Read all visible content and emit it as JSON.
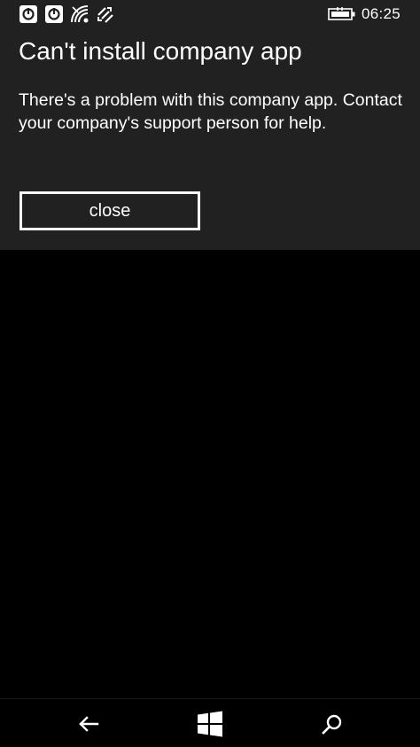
{
  "status_bar": {
    "time": "06:25",
    "icons": [
      "notification-icon",
      "notification-icon",
      "wifi-icon",
      "data-sync-icon",
      "battery-charging-icon"
    ]
  },
  "dialog": {
    "title": "Can't install company app",
    "message": "There's a problem with this company app. Contact your company's support person for help.",
    "close_label": "close"
  },
  "nav_bar": {
    "icons": [
      "back-arrow-icon",
      "windows-start-icon",
      "search-icon"
    ]
  },
  "colors": {
    "dialog_background": "#212121",
    "page_background": "#000000",
    "text": "#ffffff"
  }
}
